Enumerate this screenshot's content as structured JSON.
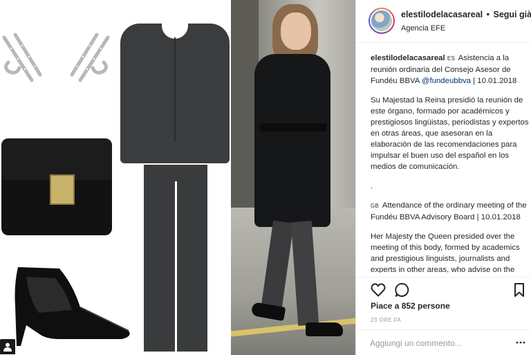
{
  "post": {
    "username": "elestilodelacasareal",
    "separator": "•",
    "follow_label": "Segui già",
    "location": "Agencia EFE"
  },
  "caption": {
    "author": "elestilodelacasareal",
    "flag_es": "ES",
    "title_es": "Asistencia a la reunión ordinaria del Consejo Asesor de Fundéu BBVA",
    "mention": "@fundeubbva",
    "date_es": "| 10.01.2018",
    "body_es": "Su Majestad la Reina presidió la reunión de este órgano, formado por académicos y prestigiosos lingüistas, periodistas y expertos en otras áreas, que asesoran en la elaboración de las recomendaciones para impulsar el buen uso del español en los medios de comunicación.",
    "dot": ".",
    "flag_gb": "GB",
    "title_en": "Attendance of the ordinary meeting of the Fundéu BBVA Advisory Board | 10.01.2018",
    "body_en": "Her Majesty the Queen presided over the meeting of this body, formed by academics and prestigious linguists, journalists and experts in other areas, who advise on the preparation of recommendations to..."
  },
  "actions": {
    "likes": "Piace a 852 persone",
    "time": "23 ORE FA"
  },
  "add_comment": {
    "placeholder": "Aggiungi un commento..."
  },
  "collage": {
    "badge_icon": "user-icon"
  },
  "colors": {
    "text": "#262626",
    "muted": "#999999",
    "mention": "#003569",
    "border": "#efefef"
  }
}
